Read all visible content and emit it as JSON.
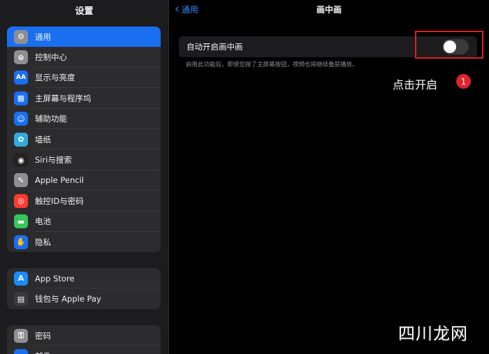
{
  "sidebar": {
    "title": "设置",
    "group1": [
      {
        "label": "通用",
        "icon": "gear-icon",
        "glyph": "⚙",
        "color": "#8e8e93",
        "selected": true
      },
      {
        "label": "控制中心",
        "icon": "control-center-icon",
        "glyph": "⊜",
        "color": "#8e8e93"
      },
      {
        "label": "显示与亮度",
        "icon": "display-brightness-icon",
        "glyph": "AA",
        "color": "#1a6ff1"
      },
      {
        "label": "主屏幕与程序坞",
        "icon": "home-screen-icon",
        "glyph": "▦",
        "color": "#1a6ff1"
      },
      {
        "label": "辅助功能",
        "icon": "accessibility-icon",
        "glyph": "☺",
        "color": "#1a6ff1"
      },
      {
        "label": "墙纸",
        "icon": "wallpaper-icon",
        "glyph": "✿",
        "color": "#34aadc"
      },
      {
        "label": "Siri与搜索",
        "icon": "siri-icon",
        "glyph": "◉",
        "color": "#222222"
      },
      {
        "label": "Apple Pencil",
        "icon": "pencil-icon",
        "glyph": "✎",
        "color": "#8e8e93"
      },
      {
        "label": "触控ID与密码",
        "icon": "fingerprint-icon",
        "glyph": "◎",
        "color": "#ff3b30"
      },
      {
        "label": "电池",
        "icon": "battery-icon",
        "glyph": "▬",
        "color": "#34c759"
      },
      {
        "label": "隐私",
        "icon": "privacy-hand-icon",
        "glyph": "✋",
        "color": "#1a6ff1"
      }
    ],
    "group2": [
      {
        "label": "App Store",
        "icon": "app-store-icon",
        "glyph": "A",
        "color": "#1a8cff"
      },
      {
        "label": "钱包与 Apple Pay",
        "icon": "wallet-icon",
        "glyph": "▤",
        "color": "#3a3a3c"
      }
    ],
    "group3": [
      {
        "label": "密码",
        "icon": "key-icon",
        "glyph": "⚿",
        "color": "#8e8e93"
      },
      {
        "label": "邮件",
        "icon": "mail-icon",
        "glyph": "✉",
        "color": "#1a6ff1"
      }
    ]
  },
  "nav": {
    "back_label": "通用",
    "title": "画中画"
  },
  "setting": {
    "label": "自动开启画中画",
    "toggle_on": false,
    "description": "启用此功能后，即使您按了主屏幕按钮，视频也将继续叠层播放。"
  },
  "annotation": {
    "text": "点击开启",
    "badge": "1",
    "highlight_color": "#e02020"
  },
  "watermark": "四川龙网",
  "colors": {
    "accent": "#2f8bff",
    "selected_row": "#1a6ff1"
  }
}
